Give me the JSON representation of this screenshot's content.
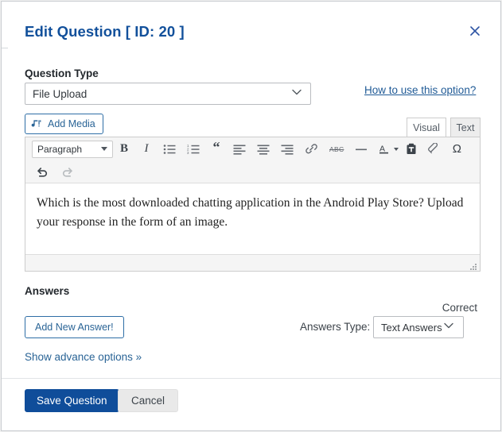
{
  "modal": {
    "title": "Edit Question [ ID: 20 ]",
    "close_icon": "close-icon"
  },
  "question_type": {
    "label": "Question Type",
    "selected": "File Upload",
    "options": [
      "File Upload"
    ],
    "help_link": "How to use this option?"
  },
  "editor": {
    "add_media_label": "Add Media",
    "tabs": [
      {
        "label": "Visual",
        "active": true
      },
      {
        "label": "Text",
        "active": false
      }
    ],
    "format_select": {
      "selected": "Paragraph",
      "options": [
        "Paragraph"
      ]
    },
    "toolbar_row1": [
      {
        "name": "bold-icon",
        "glyph": "B"
      },
      {
        "name": "italic-icon",
        "glyph": "I"
      },
      {
        "name": "bulleted-list-icon",
        "glyph": ""
      },
      {
        "name": "numbered-list-icon",
        "glyph": ""
      },
      {
        "name": "blockquote-icon",
        "glyph": "“"
      },
      {
        "name": "align-left-icon",
        "glyph": ""
      },
      {
        "name": "align-center-icon",
        "glyph": ""
      },
      {
        "name": "align-right-icon",
        "glyph": ""
      },
      {
        "name": "link-icon",
        "glyph": ""
      },
      {
        "name": "strikethrough-icon",
        "glyph": "ABC"
      },
      {
        "name": "horizontal-rule-icon",
        "glyph": ""
      },
      {
        "name": "text-color-icon",
        "glyph": "A"
      },
      {
        "name": "paste-as-text-icon",
        "glyph": ""
      },
      {
        "name": "clear-formatting-icon",
        "glyph": ""
      },
      {
        "name": "special-character-icon",
        "glyph": "Ω"
      }
    ],
    "toolbar_row2": [
      {
        "name": "undo-icon",
        "glyph": ""
      },
      {
        "name": "redo-icon",
        "glyph": ""
      }
    ],
    "content": "Which is the most downloaded chatting application in the Android Play Store? Upload your response in the form of an image."
  },
  "answers": {
    "heading": "Answers",
    "correct_label": "Correct",
    "add_answer_label": "Add New Answer!",
    "answers_type_label": "Answers Type:",
    "answers_type_selected": "Text Answers",
    "answers_type_options": [
      "Text Answers"
    ],
    "show_advance_label": "Show advance options »"
  },
  "footer": {
    "save_label": "Save Question",
    "cancel_label": "Cancel"
  },
  "colors": {
    "title_blue": "#12509b",
    "link_blue": "#2a6496",
    "primary_button": "#0f4d9a",
    "cancel_button": "#e9e9e9"
  }
}
